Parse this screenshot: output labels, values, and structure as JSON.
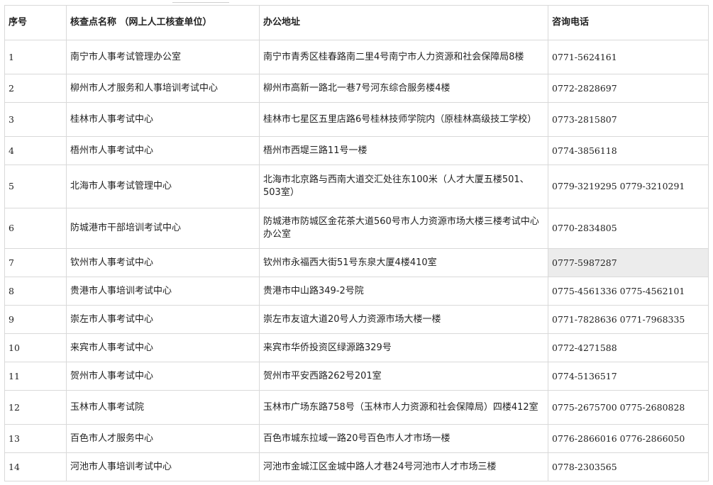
{
  "table": {
    "headers": [
      "序号",
      "核查点名称 （网上人工核查单位）",
      "办公地址",
      "咨询电话"
    ],
    "rows": [
      {
        "no": "1",
        "name": "南宁市人事考试管理办公室",
        "address": "南宁市青秀区桂春路南二里4号南宁市人力资源和社会保障局8楼",
        "phone": "0771-5624161"
      },
      {
        "no": "2",
        "name": "柳州市人才服务和人事培训考试中心",
        "address": "柳州市高新一路北一巷7号河东综合服务楼4楼",
        "phone": "0772-2828697"
      },
      {
        "no": "3",
        "name": "桂林市人事考试中心",
        "address": "桂林市七星区五里店路6号桂林技师学院内（原桂林高级技工学校）",
        "phone": "0773-2815807"
      },
      {
        "no": "4",
        "name": "梧州市人事考试中心",
        "address": "梧州市西堤三路11号一楼",
        "phone": "0774-3856118"
      },
      {
        "no": "5",
        "name": "北海市人事考试管理中心",
        "address": "北海市北京路与西南大道交汇处往东100米（人才大厦五楼501、503室）",
        "phone": "0779-3219295  0779-3210291"
      },
      {
        "no": "6",
        "name": "防城港市干部培训考试中心",
        "address": "防城港市防城区金花茶大道560号市人力资源市场大楼三楼考试中心办公室",
        "phone": "0770-2834805"
      },
      {
        "no": "7",
        "name": "钦州市人事考试中心",
        "address": "钦州市永福西大街51号东泉大厦4楼410室",
        "phone": "0777-5987287"
      },
      {
        "no": "8",
        "name": "贵港市人事培训考试中心",
        "address": "贵港市中山路349-2号院",
        "phone": "0775-4561336  0775-4562101"
      },
      {
        "no": "9",
        "name": "崇左市人事考试中心",
        "address": "崇左市友谊大道20号人力资源市场大楼一楼",
        "phone": "0771-7828636  0771-7968335"
      },
      {
        "no": "10",
        "name": "来宾市人事考试中心",
        "address": "来宾市华侨投资区绿源路329号",
        "phone": "0772-4271588"
      },
      {
        "no": "11",
        "name": "贺州市人事考试中心",
        "address": "贺州市平安西路262号201室",
        "phone": "0774-5136517"
      },
      {
        "no": "12",
        "name": "玉林市人事考试院",
        "address": "玉林市广场东路758号（玉林市人力资源和社会保障局）四楼412室",
        "phone": "0775-2675700  0775-2680828"
      },
      {
        "no": "13",
        "name": "百色市人才服务中心",
        "address": "百色市城东拉域一路20号百色市人才市场一楼",
        "phone": "0776-2866016  0776-2866050"
      },
      {
        "no": "14",
        "name": "河池市人事培训考试中心",
        "address": "河池市金城江区金城中路人才巷24号河池市人才市场三楼",
        "phone": "0778-2303565"
      }
    ]
  },
  "colors": {
    "border": "#d9d9d9",
    "highlight_cell": "#ececec",
    "text": "#222222"
  }
}
